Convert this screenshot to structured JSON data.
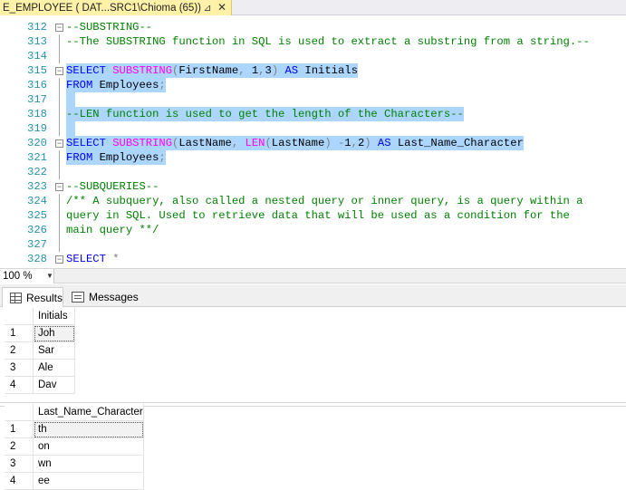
{
  "tab": {
    "title": "E_EMPLOYEE ( DAT...SRC1\\Chioma (65))",
    "pin_glyph": "⊿",
    "close_glyph": "✕"
  },
  "editor": {
    "lines": [
      {
        "num": "312",
        "fold": "−",
        "parts": [
          {
            "t": "--SUBSTRING--",
            "c": "cm"
          }
        ]
      },
      {
        "num": "313",
        "fold": "",
        "parts": [
          {
            "t": "--The SUBSTRING function in SQL is used to extract a substring from a string.--",
            "c": "cm"
          }
        ]
      },
      {
        "num": "314",
        "fold": "",
        "parts": []
      },
      {
        "num": "315",
        "fold": "−",
        "sel": true,
        "parts": [
          {
            "t": "SELECT ",
            "c": "kw"
          },
          {
            "t": "SUBSTRING",
            "c": "fn"
          },
          {
            "t": "(",
            "c": "gy"
          },
          {
            "t": "FirstName",
            "c": "tx"
          },
          {
            "t": ", ",
            "c": "gy"
          },
          {
            "t": "1",
            "c": "nm"
          },
          {
            "t": ",",
            "c": "gy"
          },
          {
            "t": "3",
            "c": "nm"
          },
          {
            "t": ") ",
            "c": "gy"
          },
          {
            "t": "AS ",
            "c": "kw"
          },
          {
            "t": "Initials",
            "c": "tx"
          }
        ]
      },
      {
        "num": "316",
        "fold": "",
        "sel": true,
        "parts": [
          {
            "t": "FROM ",
            "c": "kw"
          },
          {
            "t": "Employees",
            "c": "tx"
          },
          {
            "t": ";",
            "c": "gy"
          }
        ]
      },
      {
        "num": "317",
        "fold": "",
        "sel": true,
        "selw": 10,
        "parts": []
      },
      {
        "num": "318",
        "fold": "",
        "sel": true,
        "parts": [
          {
            "t": "--LEN function is used to get the length of the Characters--",
            "c": "cm"
          }
        ]
      },
      {
        "num": "319",
        "fold": "",
        "sel": true,
        "selw": 10,
        "parts": []
      },
      {
        "num": "320",
        "fold": "−",
        "sel": true,
        "parts": [
          {
            "t": "SELECT ",
            "c": "kw"
          },
          {
            "t": "SUBSTRING",
            "c": "fn"
          },
          {
            "t": "(",
            "c": "gy"
          },
          {
            "t": "LastName",
            "c": "tx"
          },
          {
            "t": ", ",
            "c": "gy"
          },
          {
            "t": "LEN",
            "c": "fn"
          },
          {
            "t": "(",
            "c": "gy"
          },
          {
            "t": "LastName",
            "c": "tx"
          },
          {
            "t": ") ",
            "c": "gy"
          },
          {
            "t": "-",
            "c": "gy"
          },
          {
            "t": "1",
            "c": "nm"
          },
          {
            "t": ",",
            "c": "gy"
          },
          {
            "t": "2",
            "c": "nm"
          },
          {
            "t": ") ",
            "c": "gy"
          },
          {
            "t": "AS ",
            "c": "kw"
          },
          {
            "t": "Last_Name_Character",
            "c": "tx"
          }
        ]
      },
      {
        "num": "321",
        "fold": "",
        "sel": true,
        "parts": [
          {
            "t": "FROM ",
            "c": "kw"
          },
          {
            "t": "Employees",
            "c": "tx"
          },
          {
            "t": ";",
            "c": "gy"
          }
        ]
      },
      {
        "num": "322",
        "fold": "",
        "parts": []
      },
      {
        "num": "323",
        "fold": "−",
        "parts": [
          {
            "t": "--SUBQUERIES--",
            "c": "cm"
          }
        ]
      },
      {
        "num": "324",
        "fold": "",
        "parts": [
          {
            "t": "/** A subquery, also called a nested query or inner query, is a query within a",
            "c": "cm"
          }
        ]
      },
      {
        "num": "325",
        "fold": "",
        "parts": [
          {
            "t": "query in SQL. Used to retrieve data that will be used as a condition for the",
            "c": "cm"
          }
        ]
      },
      {
        "num": "326",
        "fold": "",
        "parts": [
          {
            "t": "main query **/",
            "c": "cm"
          }
        ]
      },
      {
        "num": "327",
        "fold": "",
        "parts": []
      },
      {
        "num": "328",
        "fold": "−",
        "parts": [
          {
            "t": "SELECT ",
            "c": "kw"
          },
          {
            "t": "*",
            "c": "gy"
          }
        ]
      }
    ]
  },
  "zoom": {
    "value": "100 %",
    "caret": "▼"
  },
  "result_tabs": {
    "results": "Results",
    "messages": "Messages"
  },
  "grid1": {
    "header": "Initials",
    "rows": [
      {
        "n": "1",
        "v": "Joh"
      },
      {
        "n": "2",
        "v": "Sar"
      },
      {
        "n": "3",
        "v": "Ale"
      },
      {
        "n": "4",
        "v": "Dav"
      }
    ]
  },
  "grid2": {
    "header": "Last_Name_Character",
    "rows": [
      {
        "n": "1",
        "v": "th"
      },
      {
        "n": "2",
        "v": "on"
      },
      {
        "n": "3",
        "v": "wn"
      },
      {
        "n": "4",
        "v": "ee"
      }
    ]
  }
}
